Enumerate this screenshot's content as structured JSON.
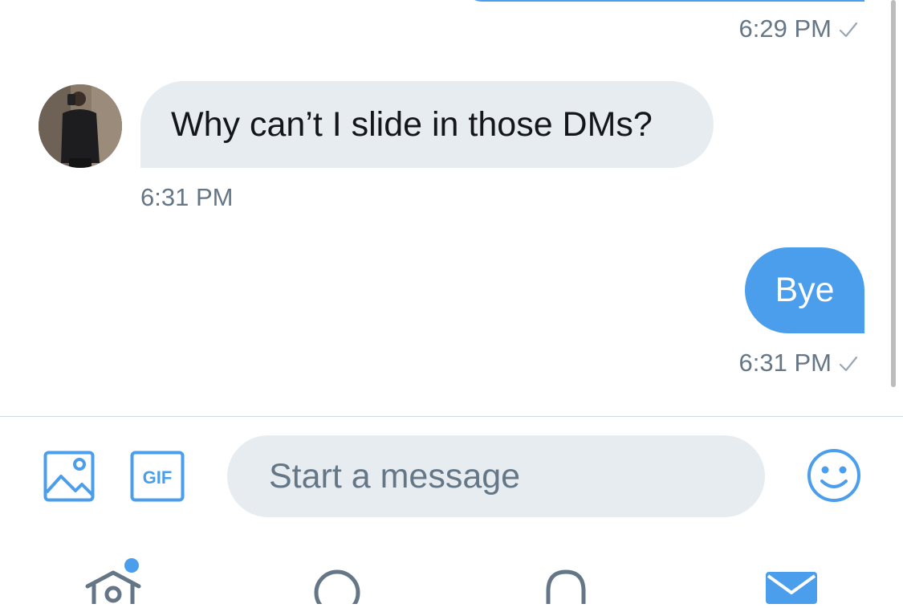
{
  "conversation": {
    "previous_outgoing": {
      "timestamp": "6:29 PM"
    },
    "incoming": {
      "text": "Why can’t I slide in those DMs?",
      "timestamp": "6:31 PM"
    },
    "outgoing": {
      "text": "Bye",
      "timestamp": "6:31 PM"
    }
  },
  "composer": {
    "placeholder": "Start a message",
    "gif_label": "GIF",
    "icons": [
      "image-icon",
      "gif-icon",
      "emoji-icon"
    ]
  },
  "tabbar": {
    "tabs": [
      "home",
      "search",
      "notifications",
      "messages"
    ],
    "home_has_unread_dot": true,
    "active_tab": "messages"
  },
  "colors": {
    "accent": "#4a9eec",
    "incoming_bubble": "#e6ecf0",
    "timestamp": "#657786",
    "text": "#14171a",
    "inactive_icon": "#657786"
  }
}
